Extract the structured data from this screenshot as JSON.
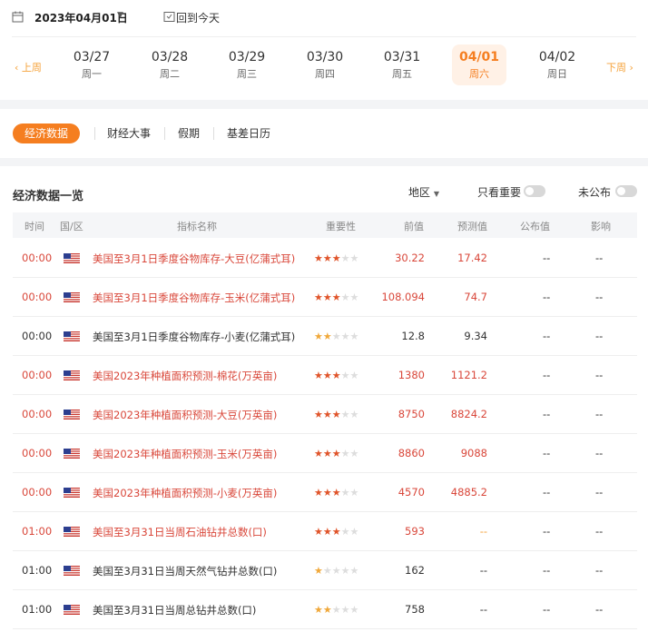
{
  "header": {
    "date": "2023年04月01日",
    "today_label": "回到今天"
  },
  "week": {
    "prev_label": "上周",
    "next_label": "下周",
    "days": [
      {
        "date": "03/27",
        "weekday": "周一",
        "active": false
      },
      {
        "date": "03/28",
        "weekday": "周二",
        "active": false
      },
      {
        "date": "03/29",
        "weekday": "周三",
        "active": false
      },
      {
        "date": "03/30",
        "weekday": "周四",
        "active": false
      },
      {
        "date": "03/31",
        "weekday": "周五",
        "active": false
      },
      {
        "date": "04/01",
        "weekday": "周六",
        "active": true
      },
      {
        "date": "04/02",
        "weekday": "周日",
        "active": false
      }
    ]
  },
  "tabs": [
    "经济数据",
    "财经大事",
    "假期",
    "基差日历"
  ],
  "section": {
    "title": "经济数据一览",
    "region_label": "地区",
    "important_only_label": "只看重要",
    "unpublished_label": "未公布"
  },
  "table": {
    "headers": [
      "时间",
      "国/区",
      "指标名称",
      "重要性",
      "前值",
      "预测值",
      "公布值",
      "影响"
    ],
    "rows": [
      {
        "time": "00:00",
        "country": "美国",
        "name": "美国至3月1日季度谷物库存-大豆(亿蒲式耳)",
        "stars": 3,
        "prev": "30.22",
        "forecast": "17.42",
        "actual": "--",
        "impact": "--",
        "highlight": true
      },
      {
        "time": "00:00",
        "country": "美国",
        "name": "美国至3月1日季度谷物库存-玉米(亿蒲式耳)",
        "stars": 3,
        "prev": "108.094",
        "forecast": "74.7",
        "actual": "--",
        "impact": "--",
        "highlight": true
      },
      {
        "time": "00:00",
        "country": "美国",
        "name": "美国至3月1日季度谷物库存-小麦(亿蒲式耳)",
        "stars": 2,
        "prev": "12.8",
        "forecast": "9.34",
        "actual": "--",
        "impact": "--",
        "highlight": false
      },
      {
        "time": "00:00",
        "country": "美国",
        "name": "美国2023年种植面积预测-棉花(万英亩)",
        "stars": 3,
        "prev": "1380",
        "forecast": "1121.2",
        "actual": "--",
        "impact": "--",
        "highlight": true
      },
      {
        "time": "00:00",
        "country": "美国",
        "name": "美国2023年种植面积预测-大豆(万英亩)",
        "stars": 3,
        "prev": "8750",
        "forecast": "8824.2",
        "actual": "--",
        "impact": "--",
        "highlight": true
      },
      {
        "time": "00:00",
        "country": "美国",
        "name": "美国2023年种植面积预测-玉米(万英亩)",
        "stars": 3,
        "prev": "8860",
        "forecast": "9088",
        "actual": "--",
        "impact": "--",
        "highlight": true
      },
      {
        "time": "00:00",
        "country": "美国",
        "name": "美国2023年种植面积预测-小麦(万英亩)",
        "stars": 3,
        "prev": "4570",
        "forecast": "4885.2",
        "actual": "--",
        "impact": "--",
        "highlight": true
      },
      {
        "time": "01:00",
        "country": "美国",
        "name": "美国至3月31日当周石油钻井总数(口)",
        "stars": 3,
        "prev": "593",
        "forecast": "--",
        "actual": "--",
        "impact": "--",
        "highlight": true
      },
      {
        "time": "01:00",
        "country": "美国",
        "name": "美国至3月31日当周天然气钻井总数(口)",
        "stars": 1,
        "prev": "162",
        "forecast": "--",
        "actual": "--",
        "impact": "--",
        "highlight": false
      },
      {
        "time": "01:00",
        "country": "美国",
        "name": "美国至3月31日当周总钻井总数(口)",
        "stars": 2,
        "prev": "758",
        "forecast": "--",
        "actual": "--",
        "impact": "--",
        "highlight": false
      }
    ]
  },
  "colors": {
    "accent": "#f57e20",
    "highlight_text": "#d9473a",
    "star_active": "#e0542a",
    "star_low": "#f0a83a"
  }
}
